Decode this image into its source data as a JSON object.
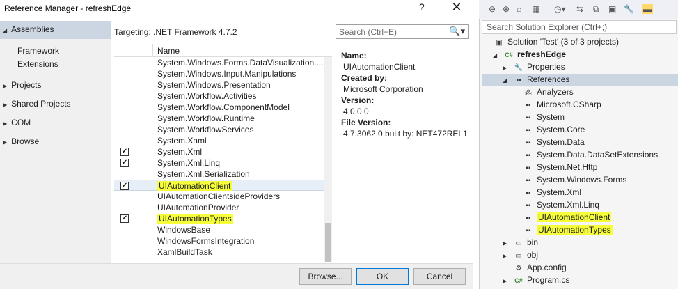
{
  "dialog": {
    "title": "Reference Manager - refreshEdge",
    "help_label": "?",
    "close_label": "✕",
    "nav": [
      {
        "label": "Assemblies",
        "expander": "◢",
        "selected": true
      },
      {
        "label": "Framework",
        "sub": true
      },
      {
        "label": "Extensions",
        "sub": true
      },
      {
        "label": "Projects",
        "expander": "▶"
      },
      {
        "label": "Shared Projects",
        "expander": "▶"
      },
      {
        "label": "COM",
        "expander": "▶"
      },
      {
        "label": "Browse",
        "expander": "▶"
      }
    ],
    "targeting": "Targeting: .NET Framework 4.7.2",
    "search_placeholder": "Search (Ctrl+E)",
    "search_icon": "🔍▾",
    "column_name": "Name",
    "rows": [
      {
        "name": "System.Windows.Forms.DataVisualization....",
        "checked": false
      },
      {
        "name": "System.Windows.Input.Manipulations",
        "checked": false
      },
      {
        "name": "System.Windows.Presentation",
        "checked": false
      },
      {
        "name": "System.Workflow.Activities",
        "checked": false
      },
      {
        "name": "System.Workflow.ComponentModel",
        "checked": false
      },
      {
        "name": "System.Workflow.Runtime",
        "checked": false
      },
      {
        "name": "System.WorkflowServices",
        "checked": false
      },
      {
        "name": "System.Xaml",
        "checked": false
      },
      {
        "name": "System.Xml",
        "checked": true
      },
      {
        "name": "System.Xml.Linq",
        "checked": true
      },
      {
        "name": "System.Xml.Serialization",
        "checked": false
      },
      {
        "name": "UIAutomationClient",
        "checked": true,
        "highlight": true,
        "selected": true
      },
      {
        "name": "UIAutomationClientsideProviders",
        "checked": false
      },
      {
        "name": "UIAutomationProvider",
        "checked": false
      },
      {
        "name": "UIAutomationTypes",
        "checked": true,
        "highlight": true
      },
      {
        "name": "WindowsBase",
        "checked": false
      },
      {
        "name": "WindowsFormsIntegration",
        "checked": false
      },
      {
        "name": "XamlBuildTask",
        "checked": false
      }
    ],
    "details": {
      "name_label": "Name:",
      "name_value": "UIAutomationClient",
      "created_label": "Created by:",
      "created_value": "Microsoft Corporation",
      "version_label": "Version:",
      "version_value": "4.0.0.0",
      "file_version_label": "File Version:",
      "file_version_value": "4.7.3062.0 built by: NET472REL1"
    },
    "buttons": {
      "browse": "Browse...",
      "ok": "OK",
      "cancel": "Cancel"
    }
  },
  "solution_explorer": {
    "toolbar": [
      "⊖",
      "⊕",
      "⌂",
      "▦",
      "◷▾",
      "⇆",
      "⧉",
      "▣",
      "🔧",
      "▬"
    ],
    "search_placeholder": "Search Solution Explorer (Ctrl+;)",
    "tree": [
      {
        "label": "Solution 'Test' (3 of 3 projects)",
        "icon": "▣",
        "expander": ""
      },
      {
        "label": "refreshEdge",
        "icon": "C#",
        "expander": "◢",
        "bold": true
      },
      {
        "label": "Properties",
        "icon": "🔧",
        "expander": "▶"
      },
      {
        "label": "References",
        "icon": "▪▪",
        "expander": "◢",
        "selected": true
      },
      {
        "label": "Analyzers",
        "icon": "⁂",
        "expander": ""
      },
      {
        "label": "Microsoft.CSharp",
        "icon": "▪▪",
        "expander": ""
      },
      {
        "label": "System",
        "icon": "▪▪",
        "expander": ""
      },
      {
        "label": "System.Core",
        "icon": "▪▪",
        "expander": ""
      },
      {
        "label": "System.Data",
        "icon": "▪▪",
        "expander": ""
      },
      {
        "label": "System.Data.DataSetExtensions",
        "icon": "▪▪",
        "expander": ""
      },
      {
        "label": "System.Net.Http",
        "icon": "▪▪",
        "expander": ""
      },
      {
        "label": "System.Windows.Forms",
        "icon": "▪▪",
        "expander": ""
      },
      {
        "label": "System.Xml",
        "icon": "▪▪",
        "expander": ""
      },
      {
        "label": "System.Xml.Linq",
        "icon": "▪▪",
        "expander": ""
      },
      {
        "label": "UIAutomationClient",
        "icon": "▪▪",
        "expander": "",
        "highlight": true
      },
      {
        "label": "UIAutomationTypes",
        "icon": "▪▪",
        "expander": "",
        "highlight": true
      },
      {
        "label": "bin",
        "icon": "▭",
        "expander": "▶"
      },
      {
        "label": "obj",
        "icon": "▭",
        "expander": "▶"
      },
      {
        "label": "App.config",
        "icon": "⚙",
        "expander": ""
      },
      {
        "label": "Program.cs",
        "icon": "C#",
        "expander": "▶"
      }
    ]
  },
  "colors": {
    "highlight": "#f6ff3a",
    "selection": "#ccd6e3",
    "accent": "#0078d7"
  }
}
